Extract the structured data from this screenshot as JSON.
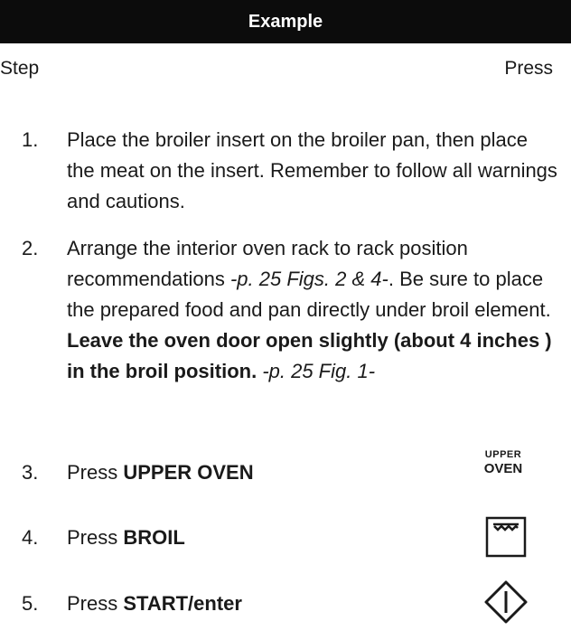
{
  "header": {
    "title": "Example"
  },
  "columns": {
    "step": "Step",
    "press": "Press"
  },
  "steps": [
    {
      "number": "1.",
      "text": "Place the broiler insert on the broiler pan, then place the meat on the insert. Remember to follow all warnings and cautions."
    },
    {
      "number": "2.",
      "text_a": "Arrange the interior oven rack to rack position recommendations ",
      "ref_a": "-p. 25 Figs. 2 & 4-",
      "text_b": ". Be sure to place the prepared food and pan directly under broil element. ",
      "bold": "Leave the oven door open slightly (about 4 inches ) in the broil position.",
      "ref_b": " -p. 25 Fig. 1-"
    },
    {
      "number": "3.",
      "prefix": "Press ",
      "key": "UPPER OVEN"
    },
    {
      "number": "4.",
      "prefix": "Press ",
      "key": "BROIL"
    },
    {
      "number": "5.",
      "prefix": "Press ",
      "key": "START/enter"
    }
  ],
  "press_icons": {
    "upper_oven_line1": "UPPER",
    "upper_oven_line2": "OVEN",
    "broil": "broil-key-icon",
    "start": "start-enter-icon"
  }
}
